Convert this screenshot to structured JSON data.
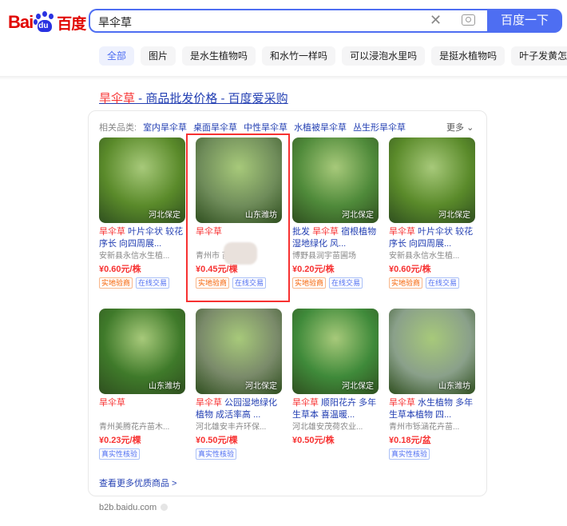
{
  "header": {
    "logo_bai": "Bai",
    "logo_du": "du",
    "logo_cn": "百度",
    "query": "旱伞草",
    "search_button": "百度一下"
  },
  "tabs": [
    "全部",
    "图片",
    "是水生植物吗",
    "和水竹一样吗",
    "可以浸泡水里吗",
    "是挺水植物吗",
    "叶子发黄怎"
  ],
  "result": {
    "title_hl": "旱伞草",
    "title_rest": " - 商品批发价格 - 百度爱采购"
  },
  "related": {
    "label": "相关品类:",
    "items": [
      "室内旱伞草",
      "桌面旱伞草",
      "中性旱伞草",
      "水植被旱伞草",
      "丛生形旱伞草"
    ],
    "more": "更多"
  },
  "products": [
    {
      "loc": "河北保定",
      "title_hl": "旱伞草",
      "title_rest": " 叶片伞状 较花序长 向四周展...",
      "seller": "安新县永信水生植...",
      "price": "¥0.60元/株",
      "badges": [
        "实地验商",
        "在线交易"
      ],
      "color": "#5a8a2a"
    },
    {
      "loc": "山东潍坊",
      "title_hl": "旱伞草",
      "title_rest": "",
      "seller": "青州市        苗...",
      "price": "¥0.45元/棵",
      "badges": [
        "实地验商",
        "在线交易"
      ],
      "color": "#6f8c5a"
    },
    {
      "loc": "河北保定",
      "title_hl": "旱伞草",
      "title_pre": "批发 ",
      "title_rest": " 宿根植物 湿地绿化 风...",
      "seller": "博野县润宇苗圃场",
      "price": "¥0.20元/株",
      "badges": [
        "实地验商",
        "在线交易"
      ],
      "color": "#4f8a3a"
    },
    {
      "loc": "河北保定",
      "title_hl": "旱伞草",
      "title_rest": " 叶片伞状 较花序长 向四周展...",
      "seller": "安新县永信水生植...",
      "price": "¥0.60元/株",
      "badges": [
        "实地验商",
        "在线交易"
      ],
      "color": "#5a8a2a"
    },
    {
      "loc": "山东潍坊",
      "title_hl": "旱伞草",
      "title_rest": "",
      "seller": "青州美腾花卉苗木...",
      "price": "¥0.23元/棵",
      "badges": [
        "真实性核验"
      ],
      "color": "#3f7a2a"
    },
    {
      "loc": "河北保定",
      "title_hl": "旱伞草",
      "title_rest": " 公园湿地绿化植物 成活率高 ...",
      "seller": "河北雄安丰卉环保...",
      "price": "¥0.50元/棵",
      "badges": [
        "真实性核验"
      ],
      "color": "#7a8a6a"
    },
    {
      "loc": "河北保定",
      "title_hl": "旱伞草",
      "title_rest": " 顺阳花卉 多年生草本 喜温暖...",
      "seller": "河北雄安茂荷农业...",
      "price": "¥0.50元/株",
      "badges": [],
      "color": "#3f8a3a"
    },
    {
      "loc": "山东潍坊",
      "title_hl": "旱伞草",
      "title_rest": " 水生植物 多年生草本植物 四...",
      "seller": "青州市铄涵花卉苗...",
      "price": "¥0.18元/盆",
      "badges": [
        "真实性核验"
      ],
      "color": "#8aa08a"
    }
  ],
  "see_more": "查看更多优质商品 >",
  "source": "b2b.baidu.com"
}
